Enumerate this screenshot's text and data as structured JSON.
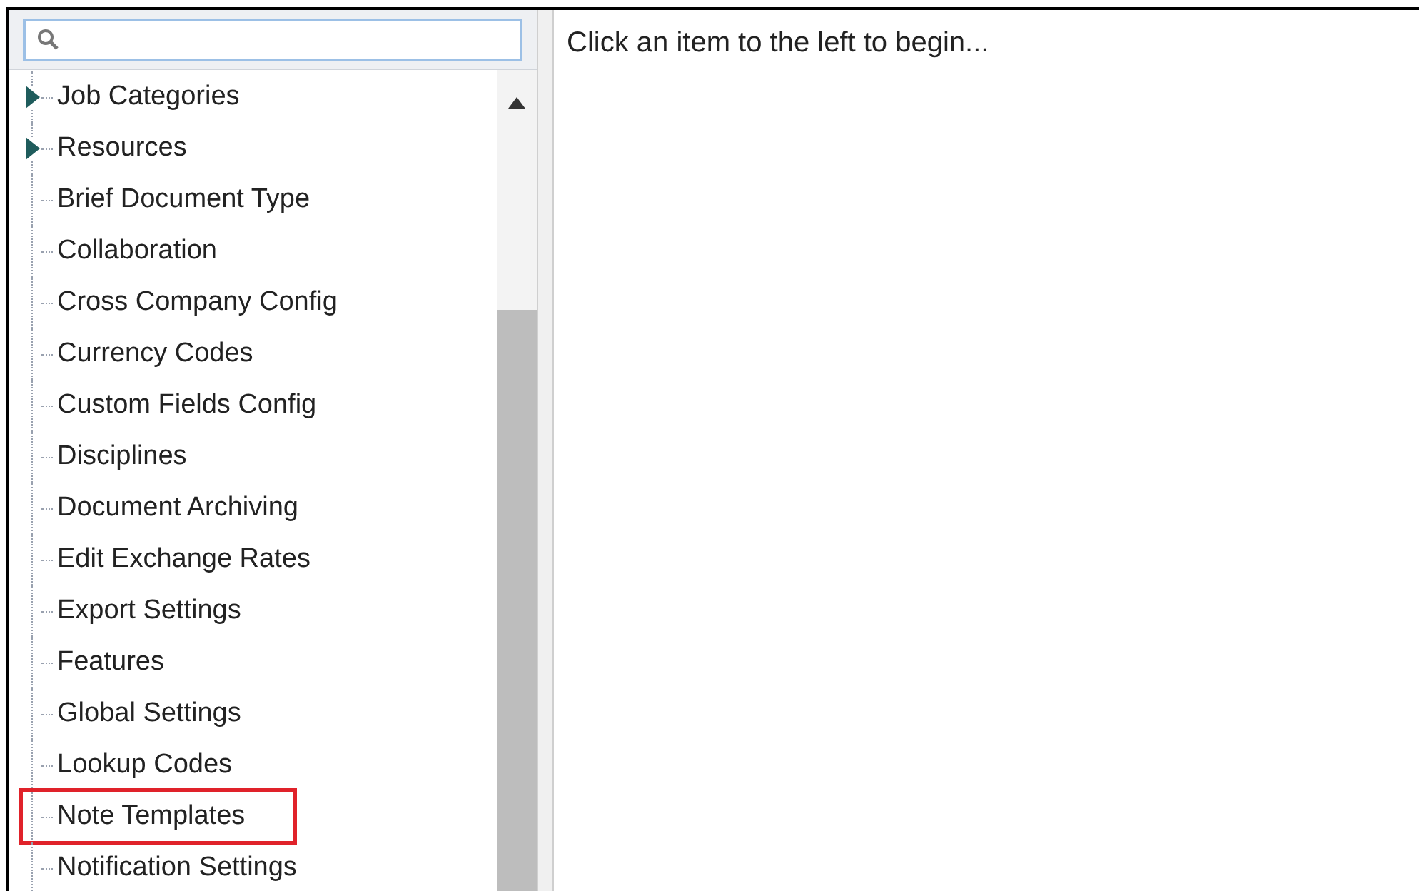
{
  "tree": {
    "items": [
      {
        "label": "Job Categories",
        "kind": "folder",
        "expanded": false,
        "highlighted": false
      },
      {
        "label": "Resources",
        "kind": "folder",
        "expanded": false,
        "highlighted": false
      },
      {
        "label": "Brief Document Type",
        "kind": "leaf",
        "highlighted": false
      },
      {
        "label": "Collaboration",
        "kind": "leaf",
        "highlighted": false
      },
      {
        "label": "Cross Company Config",
        "kind": "leaf",
        "highlighted": false
      },
      {
        "label": "Currency Codes",
        "kind": "leaf",
        "highlighted": false
      },
      {
        "label": "Custom Fields Config",
        "kind": "leaf",
        "highlighted": false
      },
      {
        "label": "Disciplines",
        "kind": "leaf",
        "highlighted": false
      },
      {
        "label": "Document Archiving",
        "kind": "leaf",
        "highlighted": false
      },
      {
        "label": "Edit Exchange Rates",
        "kind": "leaf",
        "highlighted": false
      },
      {
        "label": "Export Settings",
        "kind": "leaf",
        "highlighted": false
      },
      {
        "label": "Features",
        "kind": "leaf",
        "highlighted": false
      },
      {
        "label": "Global Settings",
        "kind": "leaf",
        "highlighted": false
      },
      {
        "label": "Lookup Codes",
        "kind": "leaf",
        "highlighted": false
      },
      {
        "label": "Note Templates",
        "kind": "leaf",
        "highlighted": true
      },
      {
        "label": "Notification Settings",
        "kind": "leaf",
        "highlighted": false
      }
    ]
  },
  "content": {
    "message": "Click an item to the left to begin..."
  }
}
